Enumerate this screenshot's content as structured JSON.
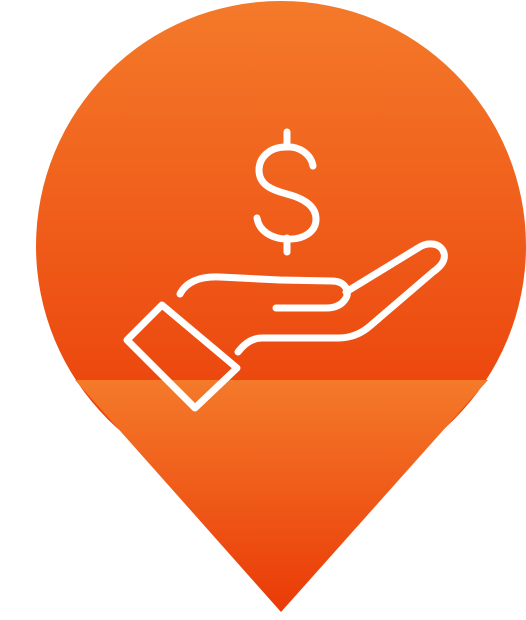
{
  "badge": {
    "shape": "map-pin",
    "icon": "hand-holding-dollar-icon",
    "symbol": "$",
    "colors": {
      "gradient_top": "#F47A2A",
      "gradient_bottom": "#EA3A07",
      "icon_stroke": "#FFFFFF",
      "background": "#FFFFFF"
    }
  }
}
